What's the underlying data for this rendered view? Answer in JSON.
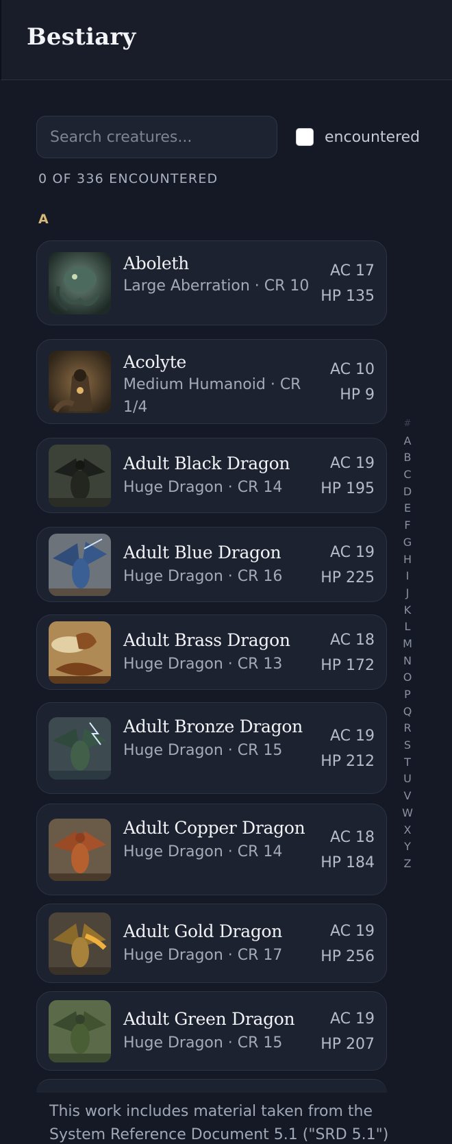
{
  "app": {
    "title": "Bestiary"
  },
  "search": {
    "placeholder": "Search creatures..."
  },
  "filter": {
    "label": "encountered",
    "checked": false
  },
  "counter": "0 OF 336 ENCOUNTERED",
  "section": {
    "letter": "A"
  },
  "creatures": [
    {
      "name": "Aboleth",
      "meta": "Large Aberration · CR 10",
      "ac": "AC 17",
      "hp": "HP 135",
      "image": "aboleth-portrait"
    },
    {
      "name": "Acolyte",
      "meta": "Medium Humanoid · CR 1/4",
      "ac": "AC 10",
      "hp": "HP 9",
      "image": "acolyte-portrait"
    },
    {
      "name": "Adult Black Dragon",
      "meta": "Huge Dragon · CR 14",
      "ac": "AC 19",
      "hp": "HP 195",
      "image": "black-dragon-portrait"
    },
    {
      "name": "Adult Blue Dragon",
      "meta": "Huge Dragon · CR 16",
      "ac": "AC 19",
      "hp": "HP 225",
      "image": "blue-dragon-portrait"
    },
    {
      "name": "Adult Brass Dragon",
      "meta": "Huge Dragon · CR 13",
      "ac": "AC 18",
      "hp": "HP 172",
      "image": "brass-dragon-portrait"
    },
    {
      "name": "Adult Bronze Dragon",
      "meta": "Huge Dragon · CR 15",
      "ac": "AC 19",
      "hp": "HP 212",
      "image": "bronze-dragon-portrait"
    },
    {
      "name": "Adult Copper Dragon",
      "meta": "Huge Dragon · CR 14",
      "ac": "AC 18",
      "hp": "HP 184",
      "image": "copper-dragon-portrait"
    },
    {
      "name": "Adult Gold Dragon",
      "meta": "Huge Dragon · CR 17",
      "ac": "AC 19",
      "hp": "HP 256",
      "image": "gold-dragon-portrait"
    },
    {
      "name": "Adult Green Dragon",
      "meta": "Huge Dragon · CR 15",
      "ac": "AC 19",
      "hp": "HP 207",
      "image": "green-dragon-portrait"
    }
  ],
  "alphabet": [
    "#",
    "A",
    "B",
    "C",
    "D",
    "E",
    "F",
    "G",
    "H",
    "I",
    "J",
    "K",
    "L",
    "M",
    "N",
    "O",
    "P",
    "Q",
    "R",
    "S",
    "T",
    "U",
    "V",
    "W",
    "X",
    "Y",
    "Z"
  ],
  "footer": {
    "text": "This work includes material taken from the System Reference Document 5.1 (\"SRD 5.1\")"
  },
  "colors": {
    "background": "#141925",
    "card": "#1c2230",
    "accent_letter": "#d8b878"
  }
}
